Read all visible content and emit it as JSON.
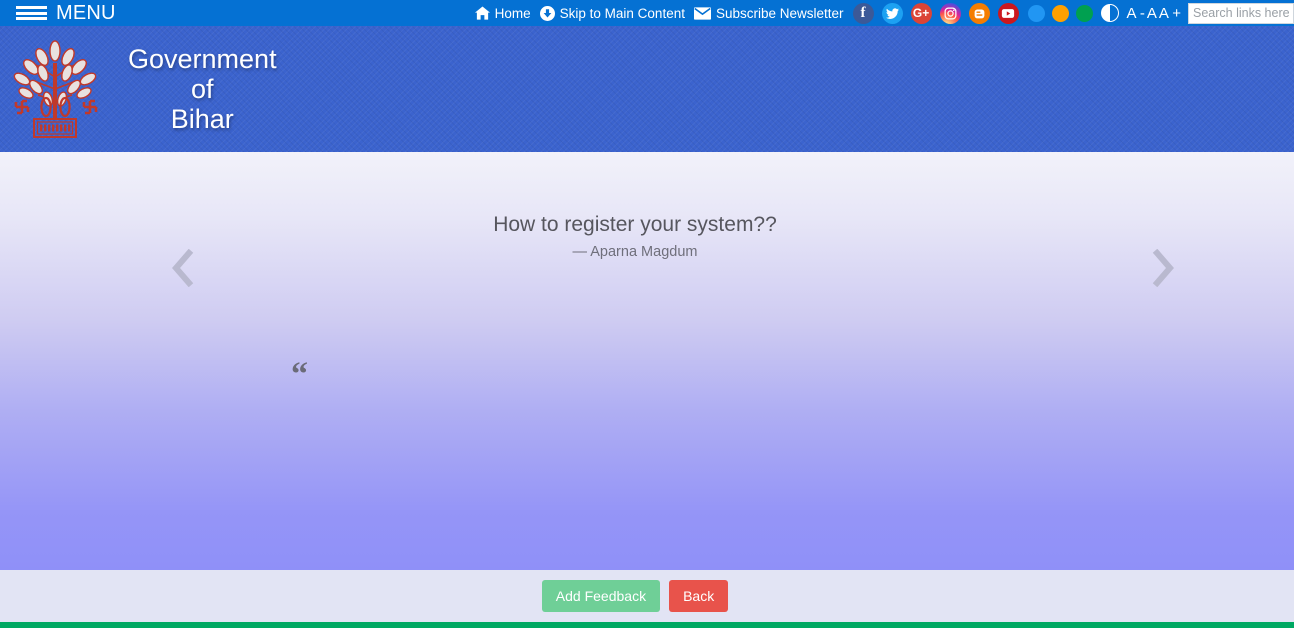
{
  "topbar": {
    "menu_label": "MENU",
    "menu_icon": "hamburger-icon",
    "links": [
      {
        "label": "Home",
        "icon": "home-icon"
      },
      {
        "label": "Skip to Main Content",
        "icon": "circle-down-arrow-icon"
      },
      {
        "label": "Subscribe Newsletter",
        "icon": "envelope-icon"
      }
    ],
    "social": [
      {
        "name": "facebook",
        "glyph": "f",
        "color": "#3b5998"
      },
      {
        "name": "twitter",
        "glyph": "",
        "color": "#1da1f2"
      },
      {
        "name": "google-plus",
        "glyph": "G+",
        "color": "#db4437"
      },
      {
        "name": "instagram",
        "glyph": "",
        "color": "#d6249f"
      },
      {
        "name": "blogger",
        "glyph": "B",
        "color": "#f57d00"
      },
      {
        "name": "youtube",
        "glyph": "",
        "color": "#cc181e"
      }
    ],
    "theme_dots": [
      {
        "name": "theme-blue",
        "color": "#2196F3"
      },
      {
        "name": "theme-orange",
        "color": "#FFA000"
      },
      {
        "name": "theme-green",
        "color": "#00A050"
      }
    ],
    "contrast_icon": "contrast-toggle-icon",
    "font_controls": [
      "A -",
      "A",
      "A +"
    ],
    "search": {
      "value": "",
      "placeholder": "Search links here"
    },
    "background_color": "#0571D3"
  },
  "brand": {
    "emblem_name": "bihar-government-emblem",
    "title_lines": [
      "Government",
      "of",
      "Bihar"
    ],
    "background_color": "#3B63CE"
  },
  "hero": {
    "prev_icon": "chevron-left-icon",
    "next_icon": "chevron-right-icon",
    "quote_icon": "double-quote-icon",
    "quote_text": "How to register your system??",
    "quote_author": "— Aparna Magdum"
  },
  "footer": {
    "add_feedback_label": "Add Feedback",
    "back_label": "Back",
    "add_feedback_color": "#6FCF97",
    "back_color": "#E8534B",
    "strip_color": "#00A862"
  }
}
